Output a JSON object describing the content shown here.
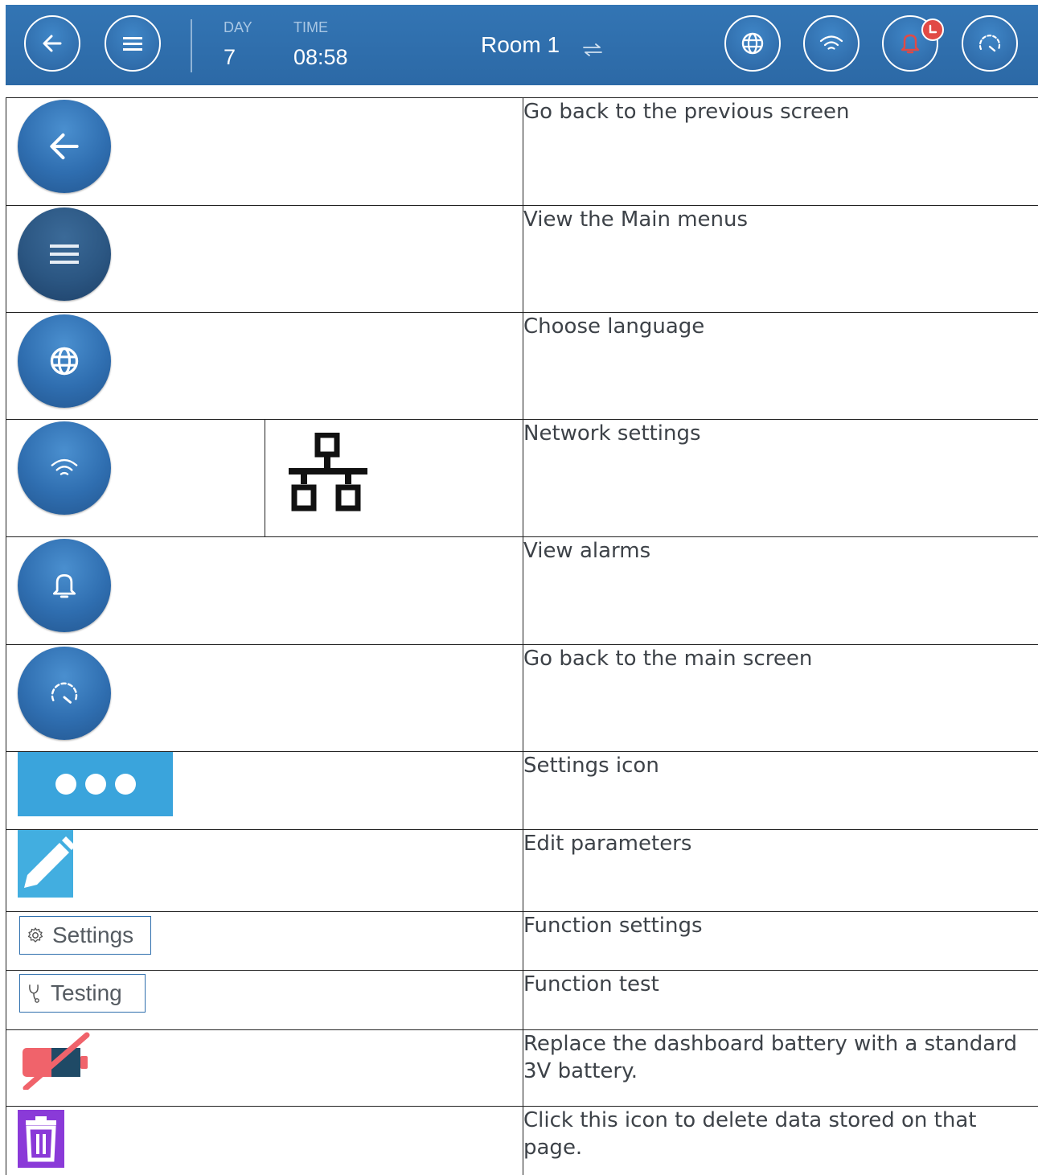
{
  "header": {
    "day_label": "DAY",
    "day_value": "7",
    "time_label": "TIME",
    "time_value": "08:58",
    "room_name": "Room 1",
    "icons": [
      "back-arrow-icon",
      "menu-icon",
      "swap-icon",
      "globe-icon",
      "wifi-icon",
      "bell-icon",
      "clock-icon",
      "gauge-icon"
    ]
  },
  "rows": [
    {
      "icon": "back-arrow-icon",
      "description": "Go back to the previous screen"
    },
    {
      "icon": "menu-icon",
      "description": "View the Main menus"
    },
    {
      "icon": "globe-icon",
      "description": "Choose language"
    },
    {
      "icon": "wifi-icon",
      "alt_icon": "network-icon",
      "description": "Network settings"
    },
    {
      "icon": "bell-icon",
      "description": "View alarms"
    },
    {
      "icon": "gauge-icon",
      "description": "Go back to the main screen"
    },
    {
      "icon": "dots-icon",
      "description": "Settings icon"
    },
    {
      "icon": "pencil-icon",
      "description": "Edit parameters"
    },
    {
      "icon": "gear-icon",
      "tag_label": "Settings",
      "description": "Function settings"
    },
    {
      "icon": "stethoscope-icon",
      "tag_label": "Testing",
      "description": "Function test"
    },
    {
      "icon": "battery-crossed-icon",
      "description": "Replace the dashboard battery with a standard 3V battery."
    },
    {
      "icon": "trash-icon",
      "description": "Click this icon to delete data stored on that page."
    }
  ],
  "colors": {
    "header_blue": "#2f6fad",
    "button_blue": "#2f6eb0",
    "alert_red": "#e14a45",
    "settings_blue": "#3aa4dc",
    "battery_red": "#f0636b",
    "trash_purple": "#8a3ad8"
  }
}
